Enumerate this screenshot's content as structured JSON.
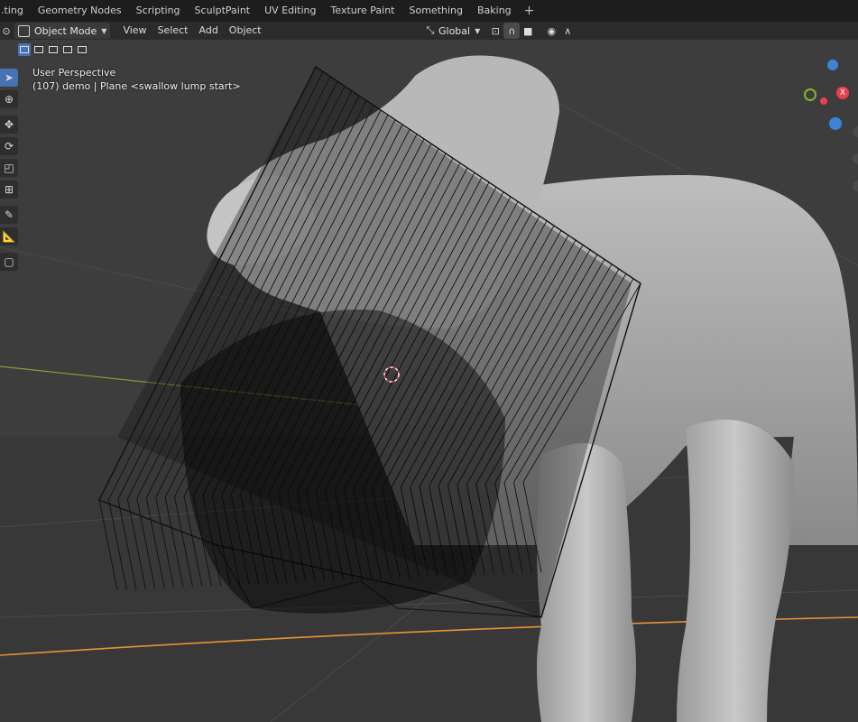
{
  "workspace_tabs": [
    "...ting",
    "Geometry Nodes",
    "Scripting",
    "SculptPaint",
    "UV Editing",
    "Texture Paint",
    "Something",
    "Baking"
  ],
  "add_tab_label": "+",
  "header": {
    "mode": "Object Mode",
    "menus": [
      "View",
      "Select",
      "Add",
      "Object"
    ],
    "transform_orientation": "Global"
  },
  "viewport": {
    "view_name": "User Perspective",
    "object_info": "(107) demo | Plane <swallow lump start>"
  },
  "tools": [
    "select-box",
    "cursor",
    "move",
    "rotate",
    "scale",
    "transform",
    "annotate",
    "measure",
    "add-cube"
  ],
  "gizmo": {
    "x_color": "#e8404f",
    "y_color": "#84b52f",
    "z_color": "#3b84d8",
    "x_label": "X"
  },
  "colors": {
    "background": "#3d3d3d",
    "header": "#2b2b2b",
    "active_tool": "#4772b3",
    "ground_line": "#e8923a",
    "x_axis_line": "#8a9e3c"
  }
}
